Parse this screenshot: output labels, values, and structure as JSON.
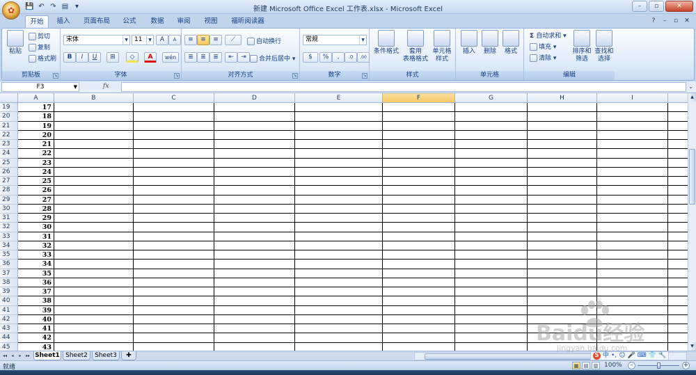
{
  "window": {
    "title": "新建 Microsoft Office Excel 工作表.xlsx - Microsoft Excel",
    "controls": [
      "–",
      "▫",
      "✕"
    ]
  },
  "office_button": {
    "glyph": "✿"
  },
  "qat": {
    "save": "💾",
    "undo": "↶",
    "redo": "↷",
    "print": "▤",
    "more": "▾"
  },
  "ribbon_tabs": [
    {
      "label": "开始",
      "active": true
    },
    {
      "label": "插入"
    },
    {
      "label": "页面布局"
    },
    {
      "label": "公式"
    },
    {
      "label": "数据"
    },
    {
      "label": "审阅"
    },
    {
      "label": "视图"
    },
    {
      "label": "福昕阅读器"
    }
  ],
  "ribbon_right": {
    "help": "?",
    "min": "–",
    "restore": "▫",
    "close": "✕"
  },
  "clipboard": {
    "paste": "粘贴",
    "cut": "剪切",
    "copy": "复制",
    "format_painter": "格式刷",
    "label": "剪贴板"
  },
  "font": {
    "name": "宋体",
    "size": "11",
    "grow": "A",
    "shrink": "A",
    "bold": "B",
    "italic": "I",
    "underline": "U",
    "border": "⊞",
    "fill": "◇",
    "color": "A",
    "phonetic": "wén",
    "label": "字体"
  },
  "alignment": {
    "wrap": "自动换行",
    "merge": "合并后居中",
    "label": "对齐方式"
  },
  "number": {
    "format": "常规",
    "currency": "$",
    "percent": "%",
    "comma": ",",
    "inc": ".0",
    "dec": ".00",
    "label": "数字"
  },
  "styles": {
    "cond": "条件格式",
    "table_1": "套用",
    "table_2": "表格格式",
    "cell_1": "单元格",
    "cell_2": "样式",
    "label": "样式"
  },
  "cells": {
    "insert": "插入",
    "delete": "删除",
    "format": "格式",
    "label": "单元格"
  },
  "editing": {
    "autosum": "自动求和",
    "fill": "填充",
    "clear": "清除",
    "sort_1": "排序和",
    "sort_2": "筛选",
    "find_1": "查找和",
    "find_2": "选择",
    "label": "编辑"
  },
  "formula_bar": {
    "name_box": "F3",
    "fx": "fx",
    "value": ""
  },
  "columns": [
    "A",
    "B",
    "C",
    "D",
    "E",
    "F",
    "G",
    "H",
    "I"
  ],
  "selected_column": "F",
  "rows": [
    {
      "num": "19",
      "a": "17"
    },
    {
      "num": "20",
      "a": "18"
    },
    {
      "num": "21",
      "a": "19"
    },
    {
      "num": "22",
      "a": "20"
    },
    {
      "num": "23",
      "a": "21"
    },
    {
      "num": "24",
      "a": "22"
    },
    {
      "num": "25",
      "a": "23"
    },
    {
      "num": "26",
      "a": "24"
    },
    {
      "num": "27",
      "a": "25"
    },
    {
      "num": "28",
      "a": "26"
    },
    {
      "num": "29",
      "a": "27"
    },
    {
      "num": "30",
      "a": "28"
    },
    {
      "num": "31",
      "a": "29"
    },
    {
      "num": "32",
      "a": "30"
    },
    {
      "num": "33",
      "a": "31"
    },
    {
      "num": "34",
      "a": "32"
    },
    {
      "num": "35",
      "a": "33"
    },
    {
      "num": "36",
      "a": "34"
    },
    {
      "num": "37",
      "a": "35"
    },
    {
      "num": "38",
      "a": "36"
    },
    {
      "num": "39",
      "a": "37"
    },
    {
      "num": "40",
      "a": "38"
    },
    {
      "num": "41",
      "a": "39"
    },
    {
      "num": "42",
      "a": "40"
    },
    {
      "num": "43",
      "a": "41"
    },
    {
      "num": "44",
      "a": "42"
    },
    {
      "num": "45",
      "a": "43"
    }
  ],
  "sheets": [
    {
      "label": "Sheet1",
      "active": true
    },
    {
      "label": "Sheet2"
    },
    {
      "label": "Sheet3"
    }
  ],
  "sheet_nav": [
    "◂◂",
    "◂",
    "▸",
    "▸▸"
  ],
  "status": {
    "ready": "就绪",
    "zoom": "100%",
    "minus": "–",
    "plus": "+"
  },
  "ime": {
    "logo": "S",
    "mode": "中",
    "punct": "•,",
    "emoji": "☺",
    "mic": "🎤",
    "kbd": "⌨",
    "skin": "👕",
    "tool": "🔧"
  },
  "watermark": {
    "brand": "Baidu经验",
    "url": "jingyan.baidu.com"
  }
}
